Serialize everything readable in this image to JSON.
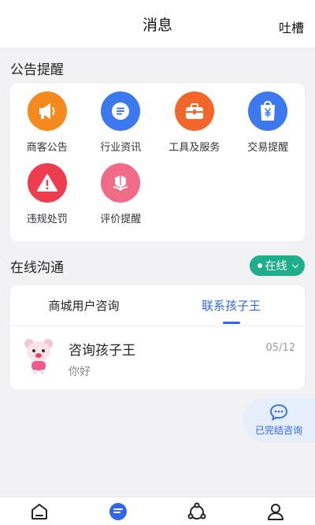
{
  "header": {
    "title": "消息",
    "feedback_label": "吐槽"
  },
  "notices": {
    "section_title": "公告提醒",
    "items": [
      {
        "label": "商客公告",
        "icon": "megaphone-icon",
        "color": "#f48a1e"
      },
      {
        "label": "行业资讯",
        "icon": "news-icon",
        "color": "#3d79ee"
      },
      {
        "label": "工具及服务",
        "icon": "toolbox-icon",
        "color": "#f2662a"
      },
      {
        "label": "交易提醒",
        "icon": "shopping-bag-icon",
        "color": "#3d79ee"
      },
      {
        "label": "违规处罚",
        "icon": "warning-icon",
        "color": "#ee3d4e"
      },
      {
        "label": "评价提醒",
        "icon": "flower-icon",
        "color": "#f06b86"
      }
    ]
  },
  "online": {
    "section_title": "在线沟通",
    "status_label": "在线",
    "tabs": [
      {
        "label": "商城用户咨询",
        "active": false
      },
      {
        "label": "联系孩子王",
        "active": true
      }
    ],
    "conversation": {
      "name": "咨询孩子王",
      "preview": "你好",
      "date": "05/12"
    }
  },
  "float_button": {
    "label": "已完结咨询"
  },
  "bottom_nav": [
    {
      "icon": "home-icon"
    },
    {
      "icon": "message-icon",
      "color": "#2f66ee"
    },
    {
      "icon": "circle-network-icon"
    },
    {
      "icon": "user-icon"
    }
  ]
}
